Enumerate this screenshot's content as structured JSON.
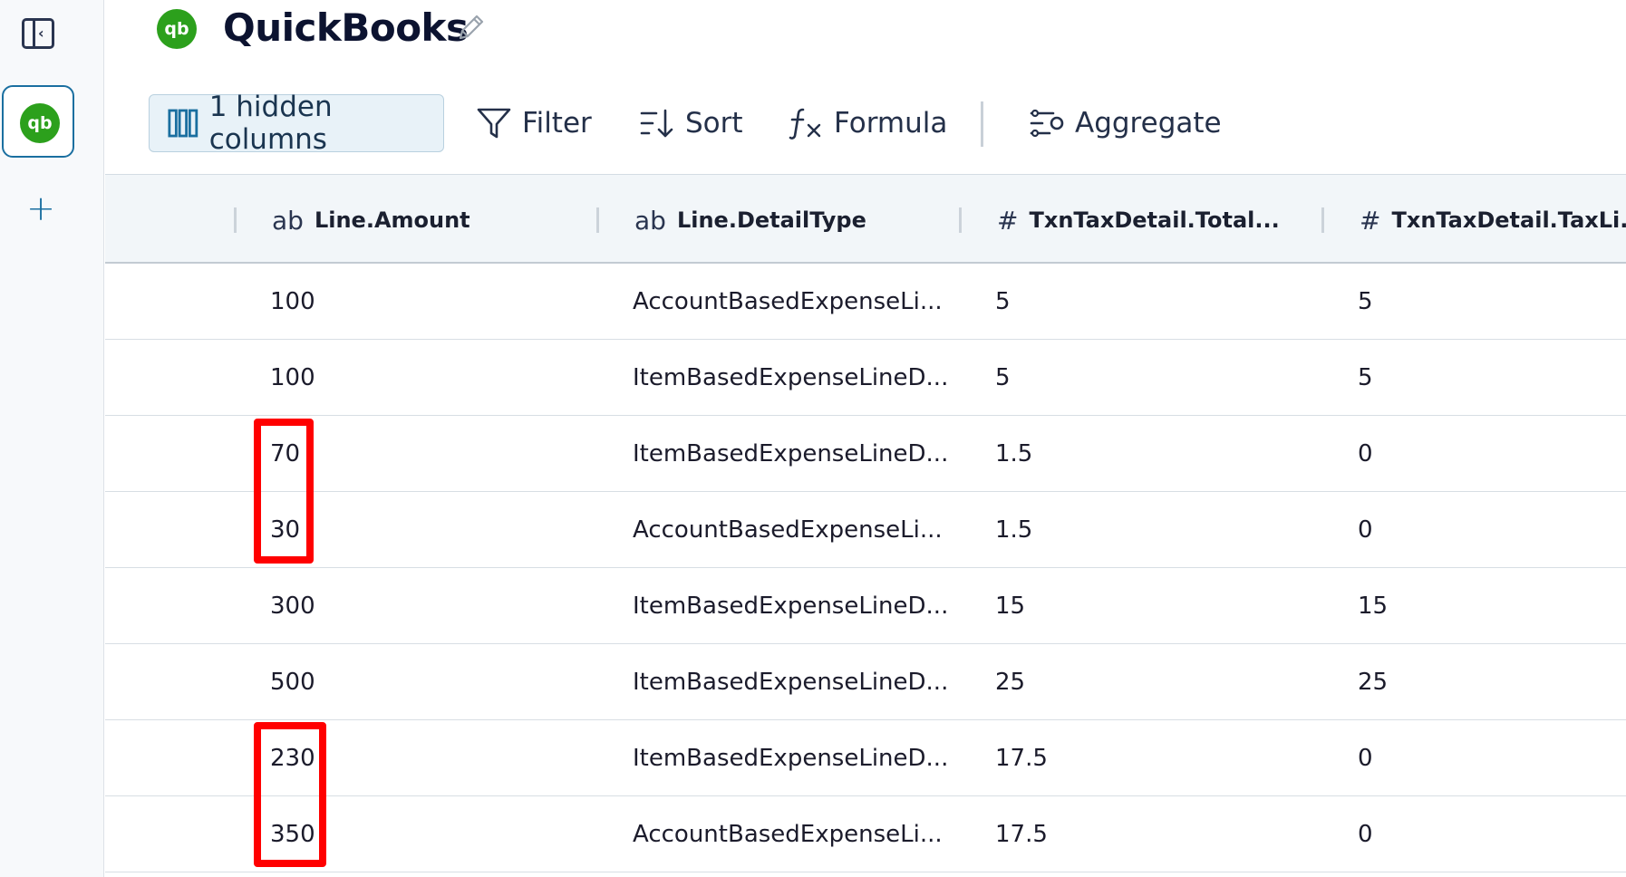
{
  "app": {
    "title": "QuickBooks",
    "logo_text": "qb",
    "brand_color": "#2ca01c",
    "accent_color": "#1a6fa0"
  },
  "rail": {
    "toggle_icon": "sidebar-collapse-icon",
    "add_symbol": "+"
  },
  "toolbar": {
    "hidden_columns_label": "1 hidden columns",
    "filter_label": "Filter",
    "sort_label": "Sort",
    "formula_label": "Formula",
    "aggregate_label": "Aggregate"
  },
  "columns": [
    {
      "type": "ab",
      "label": "Line.Amount"
    },
    {
      "type": "ab",
      "label": "Line.DetailType"
    },
    {
      "type": "#",
      "label": "TxnTaxDetail.Total..."
    },
    {
      "type": "#",
      "label": "TxnTaxDetail.TaxLi..."
    }
  ],
  "rows": [
    [
      "100",
      "AccountBasedExpenseLi...",
      "5",
      "5"
    ],
    [
      "100",
      "ItemBasedExpenseLineD...",
      "5",
      "5"
    ],
    [
      "70",
      "ItemBasedExpenseLineD...",
      "1.5",
      "0"
    ],
    [
      "30",
      "AccountBasedExpenseLi...",
      "1.5",
      "0"
    ],
    [
      "300",
      "ItemBasedExpenseLineD...",
      "15",
      "15"
    ],
    [
      "500",
      "ItemBasedExpenseLineD...",
      "25",
      "25"
    ],
    [
      "230",
      "ItemBasedExpenseLineD...",
      "17.5",
      "0"
    ],
    [
      "350",
      "AccountBasedExpenseLi...",
      "17.5",
      "0"
    ]
  ],
  "annotation_color": "#ff0000"
}
